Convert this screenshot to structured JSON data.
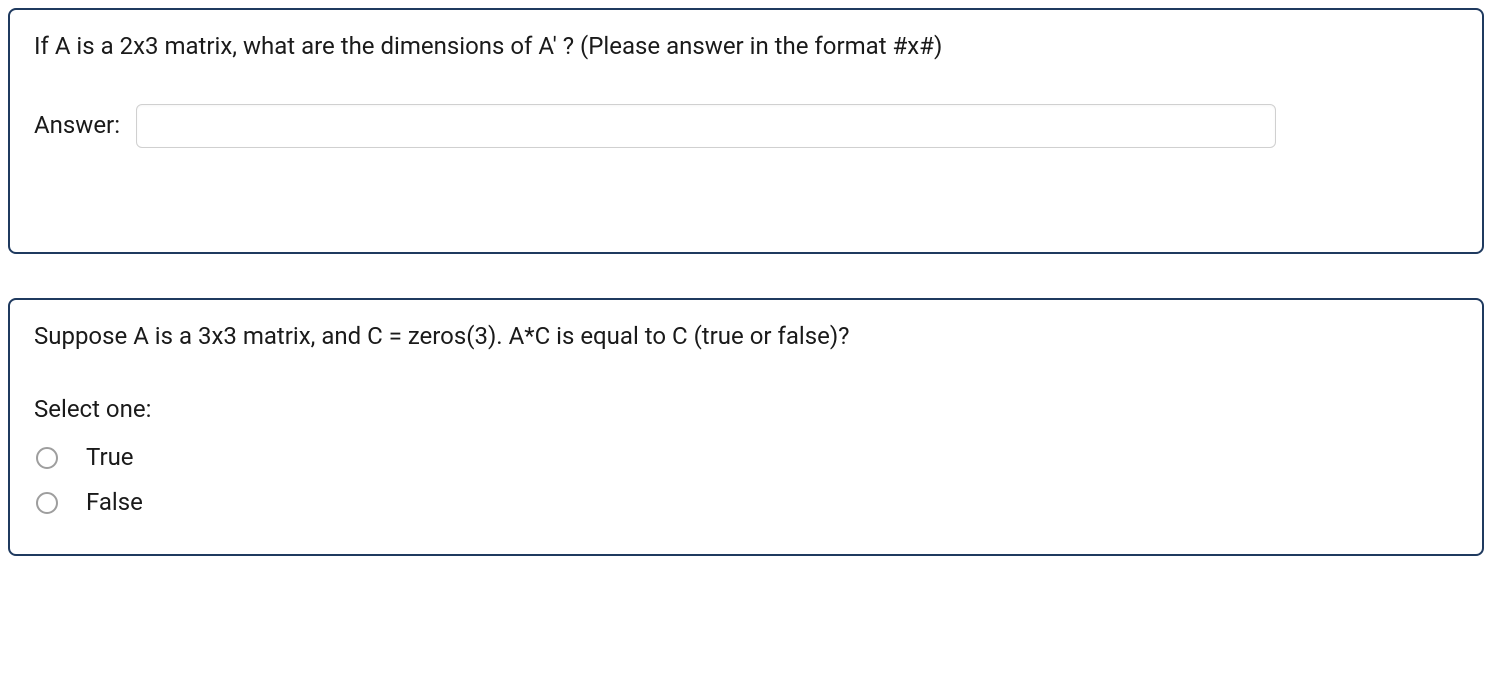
{
  "question1": {
    "text": "If A is a 2x3 matrix, what are the dimensions of A' ? (Please answer in the format #x#)",
    "answer_label": "Answer:",
    "answer_value": ""
  },
  "question2": {
    "text": "Suppose A is a 3x3 matrix, and C = zeros(3). A*C is equal to C (true or false)?",
    "select_label": "Select one:",
    "options": {
      "true": "True",
      "false": "False"
    }
  }
}
